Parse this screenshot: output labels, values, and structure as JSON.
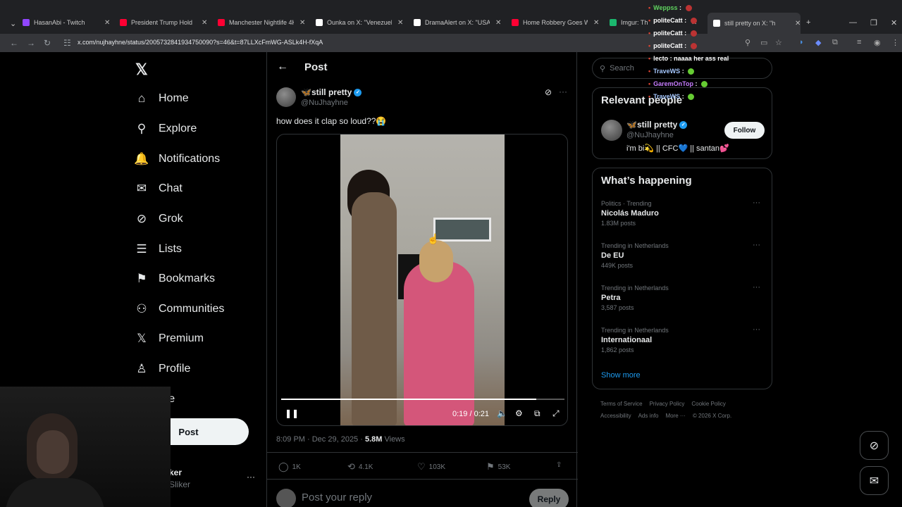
{
  "browser": {
    "tabs": [
      {
        "title": "HasanAbi - Twitch",
        "favicon_color": "#9146ff"
      },
      {
        "title": "President Trump Hold",
        "favicon_color": "#ff0033"
      },
      {
        "title": "Manchester Nightlife 4K -",
        "favicon_color": "#ff0033"
      },
      {
        "title": "Ounka on X: \"Venezuela's",
        "favicon_color": "#ffffff"
      },
      {
        "title": "DramaAlert on X: \"USA W",
        "favicon_color": "#ffffff"
      },
      {
        "title": "Home Robbery Goes Wro",
        "favicon_color": "#ff0033"
      },
      {
        "title": "Imgur: Th",
        "favicon_color": "#1bb76e"
      },
      {
        "title": "still pretty on X: \"h",
        "favicon_color": "#ffffff"
      }
    ],
    "url": "x.com/nujhayhne/status/2005732841934750090?s=46&t=87LLXcFmWG-ASLk4H-fXqA"
  },
  "nav": {
    "items": [
      {
        "label": "Home",
        "icon": "home-icon",
        "glyph": "⌂"
      },
      {
        "label": "Explore",
        "icon": "search-icon",
        "glyph": "⚲"
      },
      {
        "label": "Notifications",
        "icon": "bell-icon",
        "glyph": "🔔"
      },
      {
        "label": "Chat",
        "icon": "mail-icon",
        "glyph": "✉"
      },
      {
        "label": "Grok",
        "icon": "grok-icon",
        "glyph": "⊘"
      },
      {
        "label": "Lists",
        "icon": "list-icon",
        "glyph": "☰"
      },
      {
        "label": "Bookmarks",
        "icon": "bookmark-icon",
        "glyph": "⚑"
      },
      {
        "label": "Communities",
        "icon": "people-icon",
        "glyph": "⚇"
      },
      {
        "label": "Premium",
        "icon": "x-logo-icon",
        "glyph": "𝕏"
      },
      {
        "label": "Profile",
        "icon": "person-icon",
        "glyph": "♙"
      },
      {
        "label": "ore",
        "icon": "more-icon",
        "glyph": ""
      }
    ],
    "post_button": "Post",
    "account_name": "ker",
    "account_handle": "Sliker"
  },
  "post": {
    "header_title": "Post",
    "author_name": "🦋still pretty",
    "author_handle": "@NuJhayhne",
    "text": "how does it clap so loud??😭",
    "video_time": "0:19 / 0:21",
    "video_progress": 0.9,
    "time": "8:09 PM · Dec 29, 2025 · ",
    "views_count": "5.8M",
    "views_label": "Views",
    "actions": {
      "replies": "1K",
      "reposts": "4.1K",
      "likes": "103K",
      "bookmarks": "53K"
    },
    "reply_placeholder": "Post your reply",
    "reply_button": "Reply"
  },
  "search": {
    "placeholder": "Search"
  },
  "relevant_people": {
    "title": "Relevant people",
    "name": "🦋still pretty",
    "handle": "@NuJhayhne",
    "bio": "i'm bi💫 || CFC💙 || santan💕",
    "follow": "Follow"
  },
  "whats_happening": {
    "title": "What’s happening",
    "trends": [
      {
        "category": "Politics · Trending",
        "name": "Nicolás Maduro",
        "posts": "1.83M posts"
      },
      {
        "category": "Trending in Netherlands",
        "name": "De EU",
        "posts": "449K posts"
      },
      {
        "category": "Trending in Netherlands",
        "name": "Petra",
        "posts": "3,587 posts"
      },
      {
        "category": "Trending in Netherlands",
        "name": "Internationaal",
        "posts": "1,862 posts"
      }
    ],
    "show_more": "Show more"
  },
  "footer": {
    "row1": [
      "Terms of Service",
      "Privacy Policy",
      "Cookie Policy"
    ],
    "row2": [
      "Accessibility",
      "Ads info",
      "More ···",
      "© 2026 X Corp."
    ]
  },
  "chat": [
    {
      "user": "Weppss",
      "msg": "",
      "color": "#5fd35f"
    },
    {
      "user": "politeCatt",
      "msg": "",
      "color": "#ffffff"
    },
    {
      "user": "politeCatt",
      "msg": "",
      "color": "#ffffff"
    },
    {
      "user": "politeCatt",
      "msg": "",
      "color": "#ffffff"
    },
    {
      "user": "lecto",
      "msg": "naaaa her ass real",
      "color": "#ffffff"
    },
    {
      "user": "TraveWS",
      "msg": "",
      "color": "#a6c8ff"
    },
    {
      "user": "GaremOnTop",
      "msg": "",
      "color": "#c77dff"
    },
    {
      "user": "TraveWS",
      "msg": "",
      "color": "#a6c8ff"
    }
  ]
}
